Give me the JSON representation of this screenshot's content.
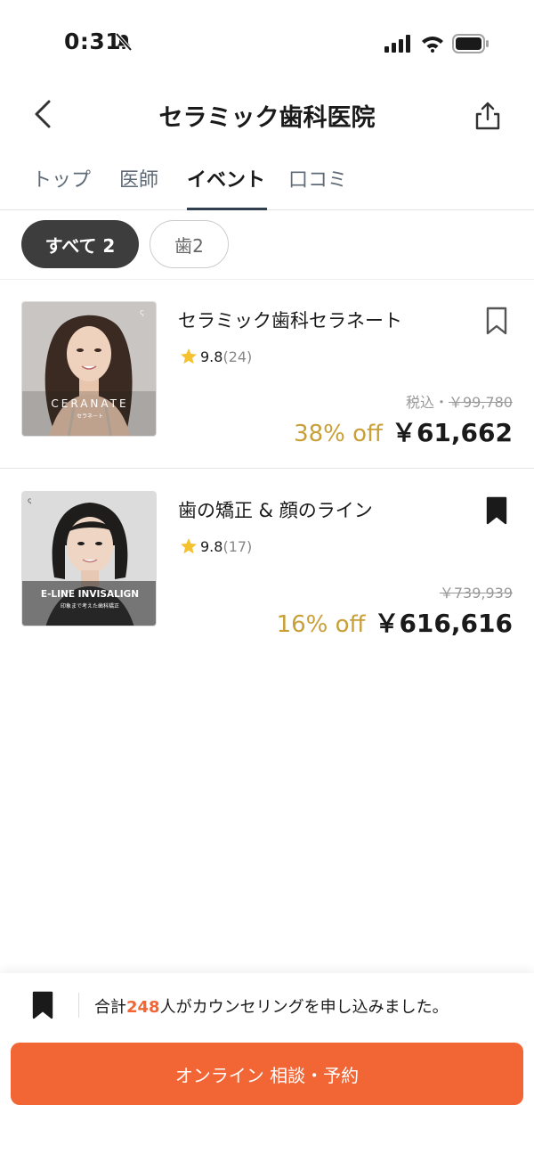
{
  "status_bar": {
    "time": "0:31"
  },
  "header": {
    "title": "セラミック歯科医院"
  },
  "tabs": [
    {
      "label": "トップ"
    },
    {
      "label": "医師"
    },
    {
      "label": "イベント"
    },
    {
      "label": "口コミ"
    }
  ],
  "filters": [
    {
      "label": "すべて 2"
    },
    {
      "label": "歯2"
    }
  ],
  "events": [
    {
      "title": "セラミック歯科セラネート",
      "rating": "9.8",
      "review_count": "(24)",
      "tax_label": "税込・",
      "original_price": "￥99,780",
      "discount": "38% off",
      "price": "￥61,662",
      "bookmarked": false,
      "thumb_title": "CERANATE",
      "thumb_subtitle": "セラネート"
    },
    {
      "title": "歯の矯正 & 顔のライン",
      "rating": "9.8",
      "review_count": "(17)",
      "tax_label": "",
      "original_price": "￥739,939",
      "discount": "16% off",
      "price": "￥616,616",
      "bookmarked": true,
      "thumb_title": "E-LINE INVISALIGN",
      "thumb_subtitle": "印象まで考えた歯科矯正"
    }
  ],
  "footer": {
    "counsel_prefix": "合計",
    "counsel_count": "248",
    "counsel_suffix": "人がカウンセリングを申し込みました。",
    "cta_label": "オンライン 相談・予約"
  },
  "colors": {
    "accent": "#f26535",
    "discount": "#c9a038",
    "active_chip": "#3d3d3d",
    "tab_underline": "#2f3f4f"
  },
  "icons": [
    "bell-off-icon",
    "signal-icon",
    "wifi-icon",
    "battery-icon",
    "back-icon",
    "share-icon",
    "star-icon",
    "bookmark-outline-icon",
    "bookmark-filled-icon"
  ]
}
